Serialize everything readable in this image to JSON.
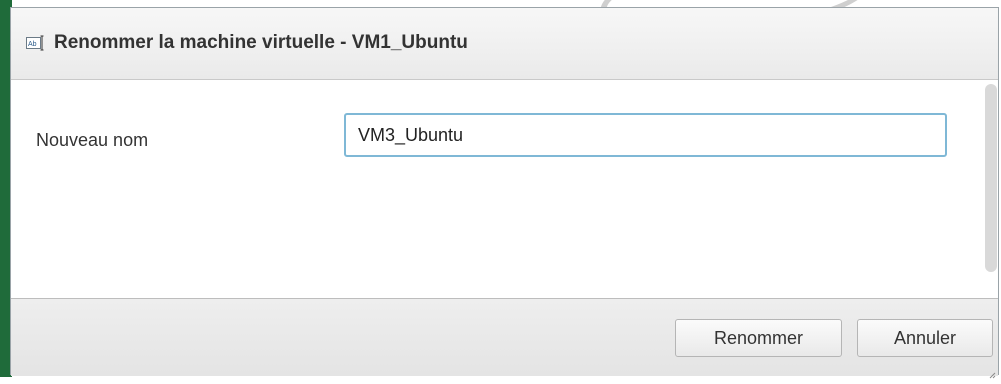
{
  "dialog": {
    "title": "Renommer la machine virtuelle - VM1_Ubuntu",
    "title_icon": "rename-icon"
  },
  "form": {
    "label": "Nouveau nom",
    "value": "VM3_Ubuntu"
  },
  "footer": {
    "rename_label": "Renommer",
    "cancel_label": "Annuler"
  },
  "colors": {
    "accent_input_border": "#7fb8d6",
    "background_left": "#1f6b3a"
  }
}
